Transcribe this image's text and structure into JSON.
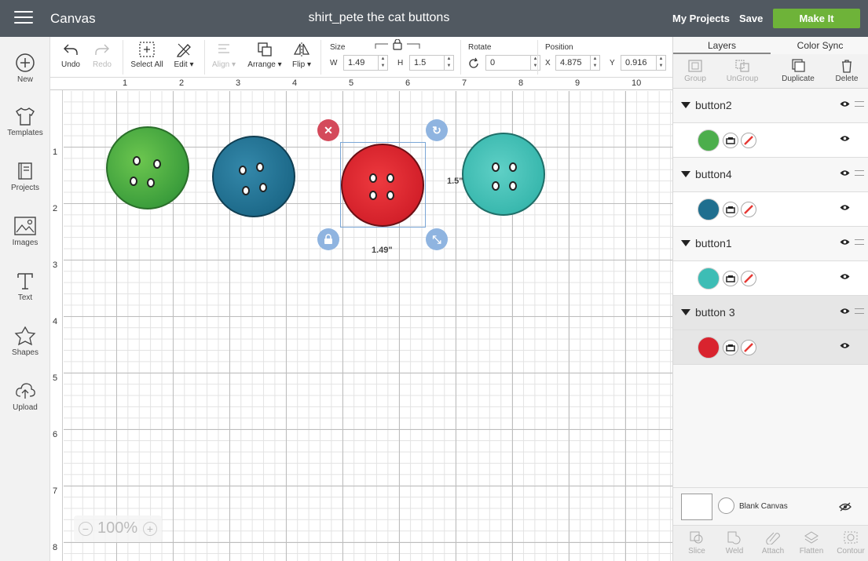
{
  "header": {
    "app_title": "Canvas",
    "doc_title": "shirt_pete the cat buttons",
    "my_projects": "My Projects",
    "save": "Save",
    "make_it": "Make It",
    "make_it_color": "#6eb339",
    "bar_color": "#515961"
  },
  "sidebar": {
    "items": [
      {
        "label": "New",
        "icon": "plus-circle-icon"
      },
      {
        "label": "Templates",
        "icon": "shirt-icon"
      },
      {
        "label": "Projects",
        "icon": "projects-icon"
      },
      {
        "label": "Images",
        "icon": "image-icon"
      },
      {
        "label": "Text",
        "icon": "text-icon"
      },
      {
        "label": "Shapes",
        "icon": "shapes-icon"
      },
      {
        "label": "Upload",
        "icon": "upload-icon"
      }
    ]
  },
  "toolbar": {
    "undo": "Undo",
    "redo": "Redo",
    "select_all": "Select All",
    "edit": "Edit",
    "align": "Align",
    "arrange": "Arrange",
    "flip": "Flip",
    "size_label": "Size",
    "w_label": "W",
    "w_value": "1.49",
    "h_label": "H",
    "h_value": "1.5",
    "rotate_label": "Rotate",
    "rotate_value": "0",
    "position_label": "Position",
    "x_label": "X",
    "x_value": "4.875",
    "y_label": "Y",
    "y_value": "0.916"
  },
  "rulers": {
    "top": [
      "1",
      "2",
      "3",
      "4",
      "5",
      "6",
      "7",
      "8",
      "9",
      "10"
    ],
    "left": [
      "1",
      "2",
      "3",
      "4",
      "5",
      "6",
      "7",
      "8"
    ]
  },
  "canvas": {
    "width_label": "1.49\"",
    "height_label": "1.5\"",
    "zoom": "100%",
    "buttons": [
      {
        "name": "green",
        "color": "#4cae4c"
      },
      {
        "name": "blue",
        "color": "#1f6f8f"
      },
      {
        "name": "red",
        "color": "#d9232e"
      },
      {
        "name": "teal",
        "color": "#3dbdb5"
      }
    ]
  },
  "panel": {
    "tab_layers": "Layers",
    "tab_color_sync": "Color Sync",
    "group": "Group",
    "ungroup": "UnGroup",
    "duplicate": "Duplicate",
    "delete": "Delete",
    "layers": [
      {
        "name": "button2",
        "color": "#4cae4c"
      },
      {
        "name": "button4",
        "color": "#1f6f8f"
      },
      {
        "name": "button1",
        "color": "#3dbdb5"
      },
      {
        "name": "button 3",
        "color": "#d9232e"
      }
    ],
    "blank_canvas": "Blank Canvas",
    "slice": "Slice",
    "weld": "Weld",
    "attach": "Attach",
    "flatten": "Flatten",
    "contour": "Contour"
  }
}
